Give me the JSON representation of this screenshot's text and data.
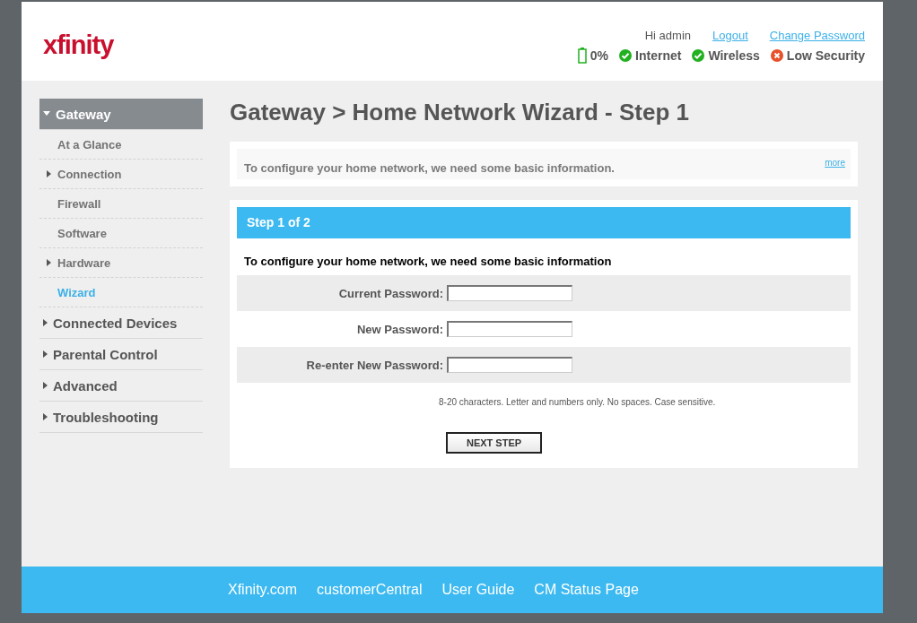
{
  "header": {
    "logo": "xfinity",
    "greeting": "Hi admin",
    "links": [
      "Logout",
      "Change Password"
    ],
    "status": [
      {
        "kind": "battery",
        "label": "0%"
      },
      {
        "kind": "ok",
        "label": "Internet"
      },
      {
        "kind": "ok",
        "label": "Wireless"
      },
      {
        "kind": "error",
        "label": "Low Security"
      }
    ]
  },
  "sidebar": {
    "items": [
      {
        "label": "Gateway",
        "expanded": true,
        "selected": true,
        "children": [
          {
            "label": "At a Glance",
            "expandable": false,
            "selected": false
          },
          {
            "label": "Connection",
            "expandable": true,
            "selected": false
          },
          {
            "label": "Firewall",
            "expandable": false,
            "selected": false
          },
          {
            "label": "Software",
            "expandable": false,
            "selected": false
          },
          {
            "label": "Hardware",
            "expandable": true,
            "selected": false
          },
          {
            "label": "Wizard",
            "expandable": false,
            "selected": true
          }
        ]
      },
      {
        "label": "Connected Devices",
        "expanded": false,
        "selected": false
      },
      {
        "label": "Parental Control",
        "expanded": false,
        "selected": false
      },
      {
        "label": "Advanced",
        "expanded": false,
        "selected": false
      },
      {
        "label": "Troubleshooting",
        "expanded": false,
        "selected": false
      }
    ]
  },
  "page_title": "Gateway > Home Network Wizard - Step 1",
  "info": {
    "text": "To configure your home network, we need some basic information.",
    "more_link": "more"
  },
  "wizard": {
    "step_header": "Step 1 of 2",
    "intro": "To configure your home network, we need some basic information",
    "fields": [
      {
        "label": "Current Password:"
      },
      {
        "label": "New Password:"
      },
      {
        "label": "Re-enter New Password:"
      }
    ],
    "hint": "8-20 characters. Letter and numbers only. No spaces. Case sensitive.",
    "button": "NEXT STEP"
  },
  "footer": {
    "links": [
      "Xfinity.com",
      "customerCentral",
      "User Guide",
      "CM Status Page"
    ]
  }
}
